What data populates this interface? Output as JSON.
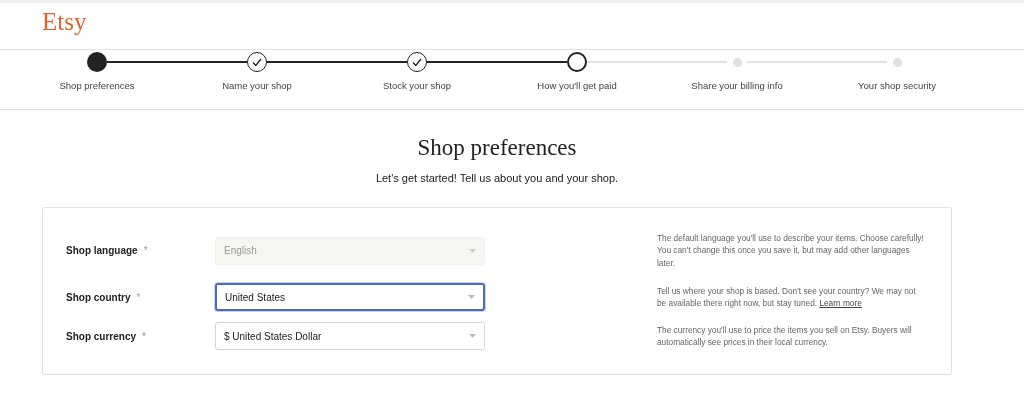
{
  "logo": "Etsy",
  "steps": [
    {
      "label": "Shop preferences",
      "kind": "current"
    },
    {
      "label": "Name your shop",
      "kind": "done"
    },
    {
      "label": "Stock your shop",
      "kind": "done"
    },
    {
      "label": "How you'll get paid",
      "kind": "open"
    },
    {
      "label": "Share your billing info",
      "kind": "upcoming"
    },
    {
      "label": "Your shop security",
      "kind": "upcoming"
    }
  ],
  "title": "Shop preferences",
  "subtitle": "Let's get started! Tell us about you and your shop.",
  "fields": [
    {
      "label": "Shop language",
      "required": "*",
      "value": "English",
      "disabled": true,
      "focused": false,
      "help": "The default language you'll use to describe your items. Choose carefully! You can't change this once you save it, but may add other languages later."
    },
    {
      "label": "Shop country",
      "required": "*",
      "value": "United States",
      "disabled": false,
      "focused": true,
      "help": "Tell us where your shop is based. Don't see your country? We may not be available there right now, but stay tuned.",
      "help_link": "Learn more"
    },
    {
      "label": "Shop currency",
      "required": "*",
      "value": "$ United States Dollar",
      "disabled": false,
      "focused": false,
      "help": "The currency you'll use to price the items you sell on Etsy. Buyers will automatically see prices in their local currency."
    }
  ]
}
